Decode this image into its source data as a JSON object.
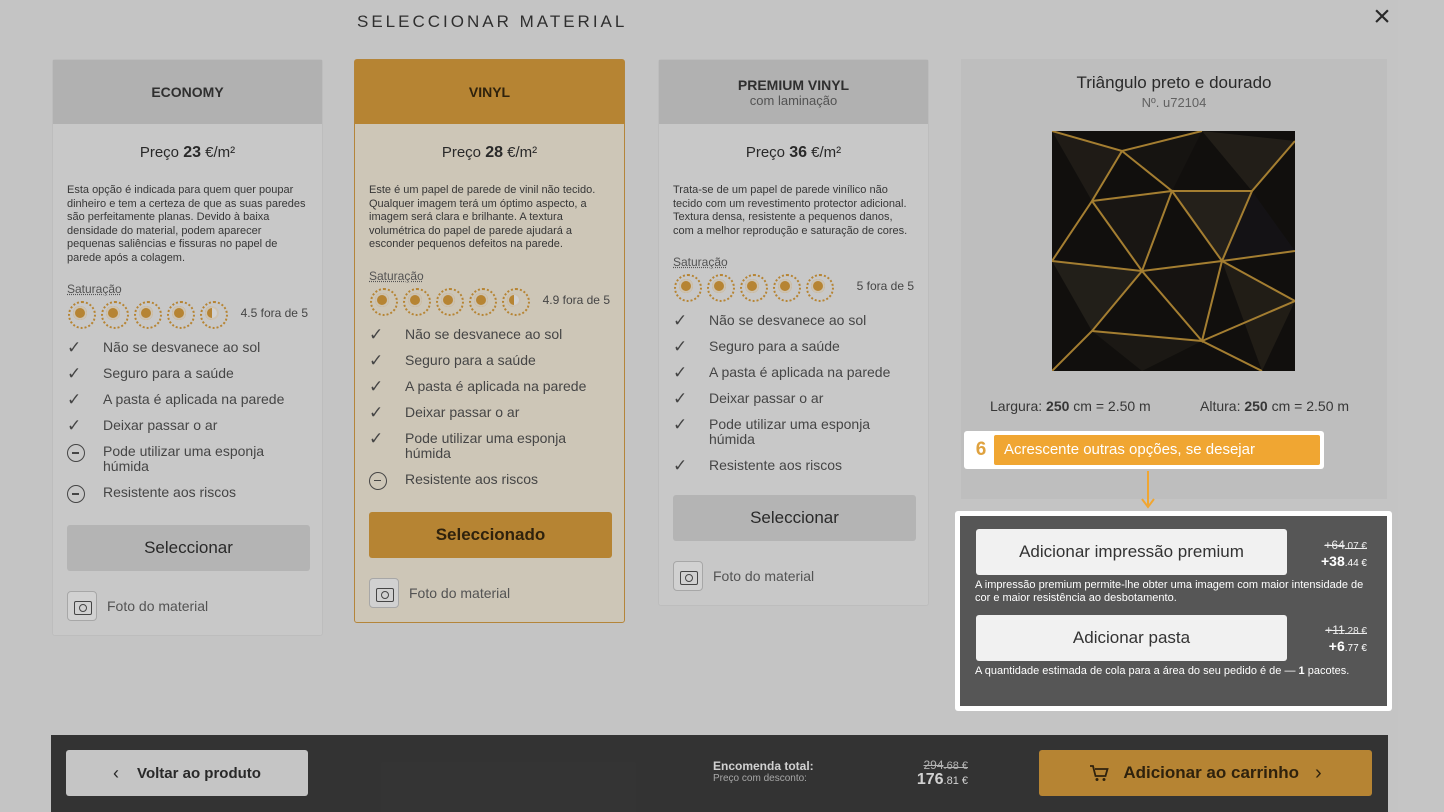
{
  "modal": {
    "title": "SELECCIONAR MATERIAL",
    "close_icon": "close-icon"
  },
  "cards": [
    {
      "name": "ECONOMY",
      "subtitle": "",
      "price_prefix": "Preço",
      "price_value": "23",
      "price_unit": "€/m²",
      "description": "Esta opção é indicada para quem quer poupar dinheiro e tem a certeza de que as suas paredes são perfeitamente planas. Devido à baixa densidade do material, podem aparecer pequenas saliências e fissuras no papel de parede após a colagem.",
      "saturation_label": "Saturação",
      "saturation_text": "4.5 fora de 5",
      "saturation_rating": 4.5,
      "features": [
        {
          "icon": "check",
          "text": "Não se desvanece ao sol"
        },
        {
          "icon": "check",
          "text": "Seguro para a saúde"
        },
        {
          "icon": "check",
          "text": "A pasta é aplicada na parede"
        },
        {
          "icon": "check",
          "text": "Deixar passar o ar"
        },
        {
          "icon": "minus",
          "text": "Pode utilizar uma esponja húmida"
        },
        {
          "icon": "minus",
          "text": "Resistente aos riscos"
        }
      ],
      "button": "Seleccionar",
      "photo_link": "Foto do material"
    },
    {
      "name": "VINYL",
      "subtitle": "",
      "price_prefix": "Preço",
      "price_value": "28",
      "price_unit": "€/m²",
      "description": "Este é um papel de parede de vinil não tecido. Qualquer imagem terá um óptimo aspecto, a imagem será clara e brilhante. A textura volumétrica do papel de parede ajudará a esconder pequenos defeitos na parede.",
      "saturation_label": "Saturação",
      "saturation_text": "4.9 fora de 5",
      "saturation_rating": 4.9,
      "features": [
        {
          "icon": "check",
          "text": "Não se desvanece ao sol"
        },
        {
          "icon": "check",
          "text": "Seguro para a saúde"
        },
        {
          "icon": "check",
          "text": "A pasta é aplicada na parede"
        },
        {
          "icon": "check",
          "text": "Deixar passar o ar"
        },
        {
          "icon": "check",
          "text": "Pode utilizar uma esponja húmida"
        },
        {
          "icon": "minus",
          "text": "Resistente aos riscos"
        }
      ],
      "button": "Seleccionado",
      "photo_link": "Foto do material"
    },
    {
      "name": "PREMIUM VINYL",
      "subtitle": "com laminação",
      "price_prefix": "Preço",
      "price_value": "36",
      "price_unit": "€/m²",
      "description": "Trata-se de um papel de parede vinílico não tecido com um revestimento protector adicional. Textura densa, resistente a pequenos danos, com a melhor reprodução e saturação de cores.",
      "saturation_label": "Saturação",
      "saturation_text": "5 fora de 5",
      "saturation_rating": 5,
      "features": [
        {
          "icon": "check",
          "text": "Não se desvanece ao sol"
        },
        {
          "icon": "check",
          "text": "Seguro para a saúde"
        },
        {
          "icon": "check",
          "text": "A pasta é aplicada na parede"
        },
        {
          "icon": "check",
          "text": "Deixar passar o ar"
        },
        {
          "icon": "check",
          "text": "Pode utilizar uma esponja húmida"
        },
        {
          "icon": "check",
          "text": "Resistente aos riscos"
        }
      ],
      "button": "Seleccionar",
      "photo_link": "Foto do material"
    }
  ],
  "selected_card": "VINYL",
  "product": {
    "title": "Triângulo preto e dourado",
    "code": "Nº. u72104",
    "width_label": "Largura:",
    "width_value": "250",
    "width_unit": "cm = 2.50 m",
    "height_label": "Altura:",
    "height_value": "250",
    "height_unit": "cm = 2.50 m"
  },
  "callout": {
    "step": "6",
    "text": "Acrescente outras opções, se desejar"
  },
  "options": [
    {
      "button": "Adicionar impressão premium",
      "old_price_main": "+64",
      "old_price_cents": ".07 €",
      "new_price_main": "+38",
      "new_price_cents": ".44 €",
      "description": "A impressão premium permite-lhe obter uma imagem com maior intensidade de cor e maior resistência ao desbotamento."
    },
    {
      "button": "Adicionar pasta",
      "old_price_main": "+11",
      "old_price_cents": ".28 €",
      "new_price_main": "+6",
      "new_price_cents": ".77 €",
      "description": "A quantidade estimada de cola para a área do seu pedido é de —",
      "description_bold": "1",
      "description_end": "pacotes."
    }
  ],
  "footer": {
    "back_button": "Voltar ao produto",
    "total_label": "Encomenda total:",
    "discount_label": "Preço com desconto:",
    "old_total_main": "294",
    "old_total_cents": ".68 €",
    "new_total_main": "176",
    "new_total_cents": ".81 €",
    "cart_button": "Adicionar ao carrinho"
  },
  "colors": {
    "accent": "#dfa23f",
    "callout": "#f0a632",
    "dark_panel": "#565656",
    "footer": "#3f3f3f"
  }
}
